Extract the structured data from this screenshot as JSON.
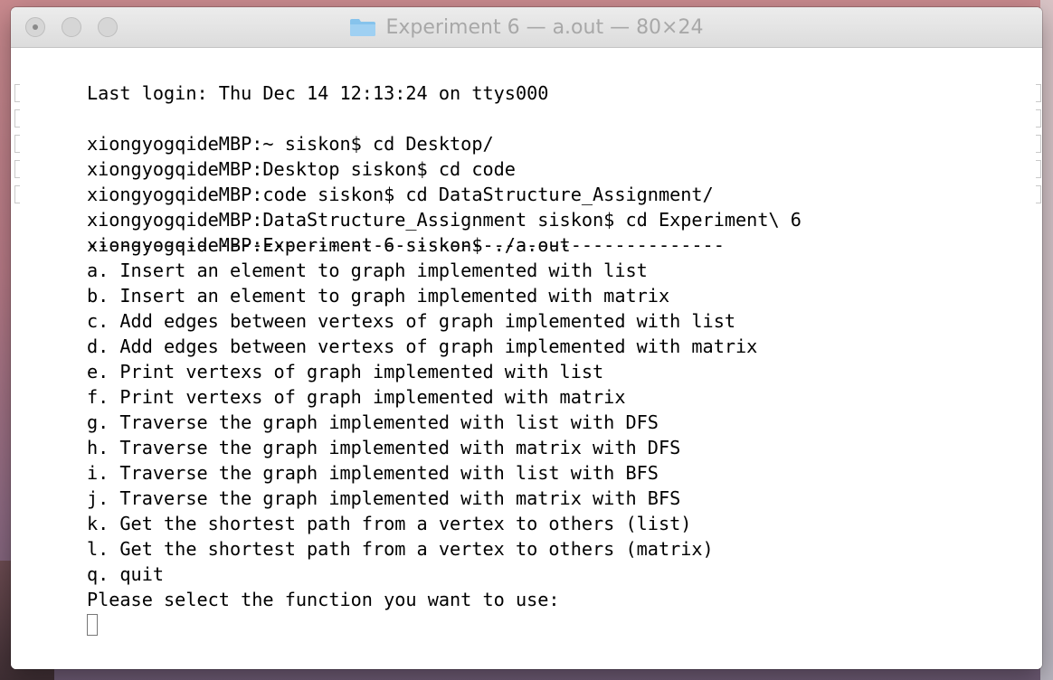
{
  "window": {
    "title": "Experiment 6 — a.out — 80×24"
  },
  "terminal": {
    "lines": [
      "Last login: Thu Dec 14 12:13:24 on ttys000",
      "xiongyogqideMBP:~ siskon$ cd Desktop/",
      "xiongyogqideMBP:Desktop siskon$ cd code",
      "xiongyogqideMBP:code siskon$ cd DataStructure_Assignment/",
      "xiongyogqideMBP:DataStructure_Assignment siskon$ cd Experiment\\ 6",
      "xiongyogqideMBP:Experiment 6 siskon$ ./a.out",
      "----------------------------------------------------------",
      "a. Insert an element to graph implemented with list",
      "b. Insert an element to graph implemented with matrix",
      "c. Add edges between vertexs of graph implemented with list",
      "d. Add edges between vertexs of graph implemented with matrix",
      "e. Print vertexs of graph implemented with list",
      "f. Print vertexs of graph implemented with matrix",
      "g. Traverse the graph implemented with list with DFS",
      "h. Traverse the graph implemented with matrix with DFS",
      "i. Traverse the graph implemented with list with BFS",
      "j. Traverse the graph implemented with matrix with BFS",
      "k. Get the shortest path from a vertex to others (list)",
      "l. Get the shortest path from a vertex to others (matrix)",
      "q. quit",
      "Please select the function you want to use:"
    ]
  },
  "icons": {
    "folder": "folder-icon",
    "cursor": "text-cursor"
  },
  "colors": {
    "folder": "#86c3ec",
    "title_text": "#a8a8a8",
    "terminal_bg": "#ffffff",
    "terminal_text": "#000000"
  }
}
